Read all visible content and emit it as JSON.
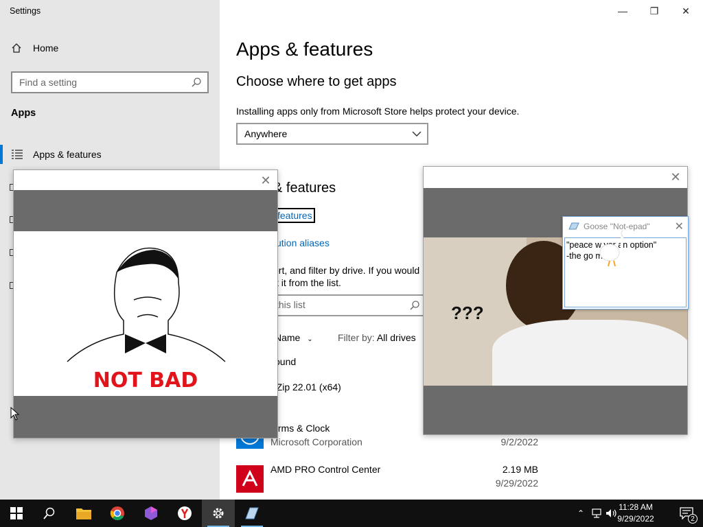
{
  "window": {
    "title": "Settings",
    "minimize_label": "—",
    "restore_label": "❐",
    "close_label": "✕"
  },
  "sidebar": {
    "home_label": "Home",
    "search_placeholder": "Find a setting",
    "section_label": "Apps",
    "active_item_label": "Apps & features"
  },
  "main": {
    "title": "Apps & features",
    "choose_heading": "Choose where to get apps",
    "install_desc": "Installing apps only from Microsoft Store helps protect your device.",
    "install_source_value": "Anywhere",
    "partial_heading": "& features",
    "optional_features_link": "features",
    "aliases_link": "ution aliases",
    "search_desc_line1": "ort, and filter by drive. If you would",
    "search_desc_line2": "t it from the list.",
    "search_list_placeholder": "this list",
    "sort_label": "Name",
    "filter_prefix": "Filter by:",
    "filter_value": "All drives",
    "apps_found_text": "ound",
    "apps": [
      {
        "name": "-Zip 22.01 (x64)",
        "publisher": "",
        "size": "",
        "date": ""
      },
      {
        "name": "larms & Clock",
        "publisher": "Microsoft Corporation",
        "size": "",
        "date": "9/2/2022"
      },
      {
        "name": "AMD PRO Control Center",
        "publisher": "",
        "size": "2.19 MB",
        "date": "9/29/2022"
      }
    ]
  },
  "popup_left": {
    "close_label": "✕",
    "image_caption": "NOT BAD"
  },
  "popup_right": {
    "close_label": "✕",
    "image_caption": "???"
  },
  "notepad": {
    "title": "Goose \"Not-epad\"",
    "close_label": "✕",
    "body_text": "\"peace w     ver an option\"\n  -the go       me)"
  },
  "taskbar": {
    "time": "11:28 AM",
    "date": "9/29/2022",
    "notification_count": "2",
    "colors": {
      "background": "#101010",
      "accent": "#76b9ed"
    }
  }
}
